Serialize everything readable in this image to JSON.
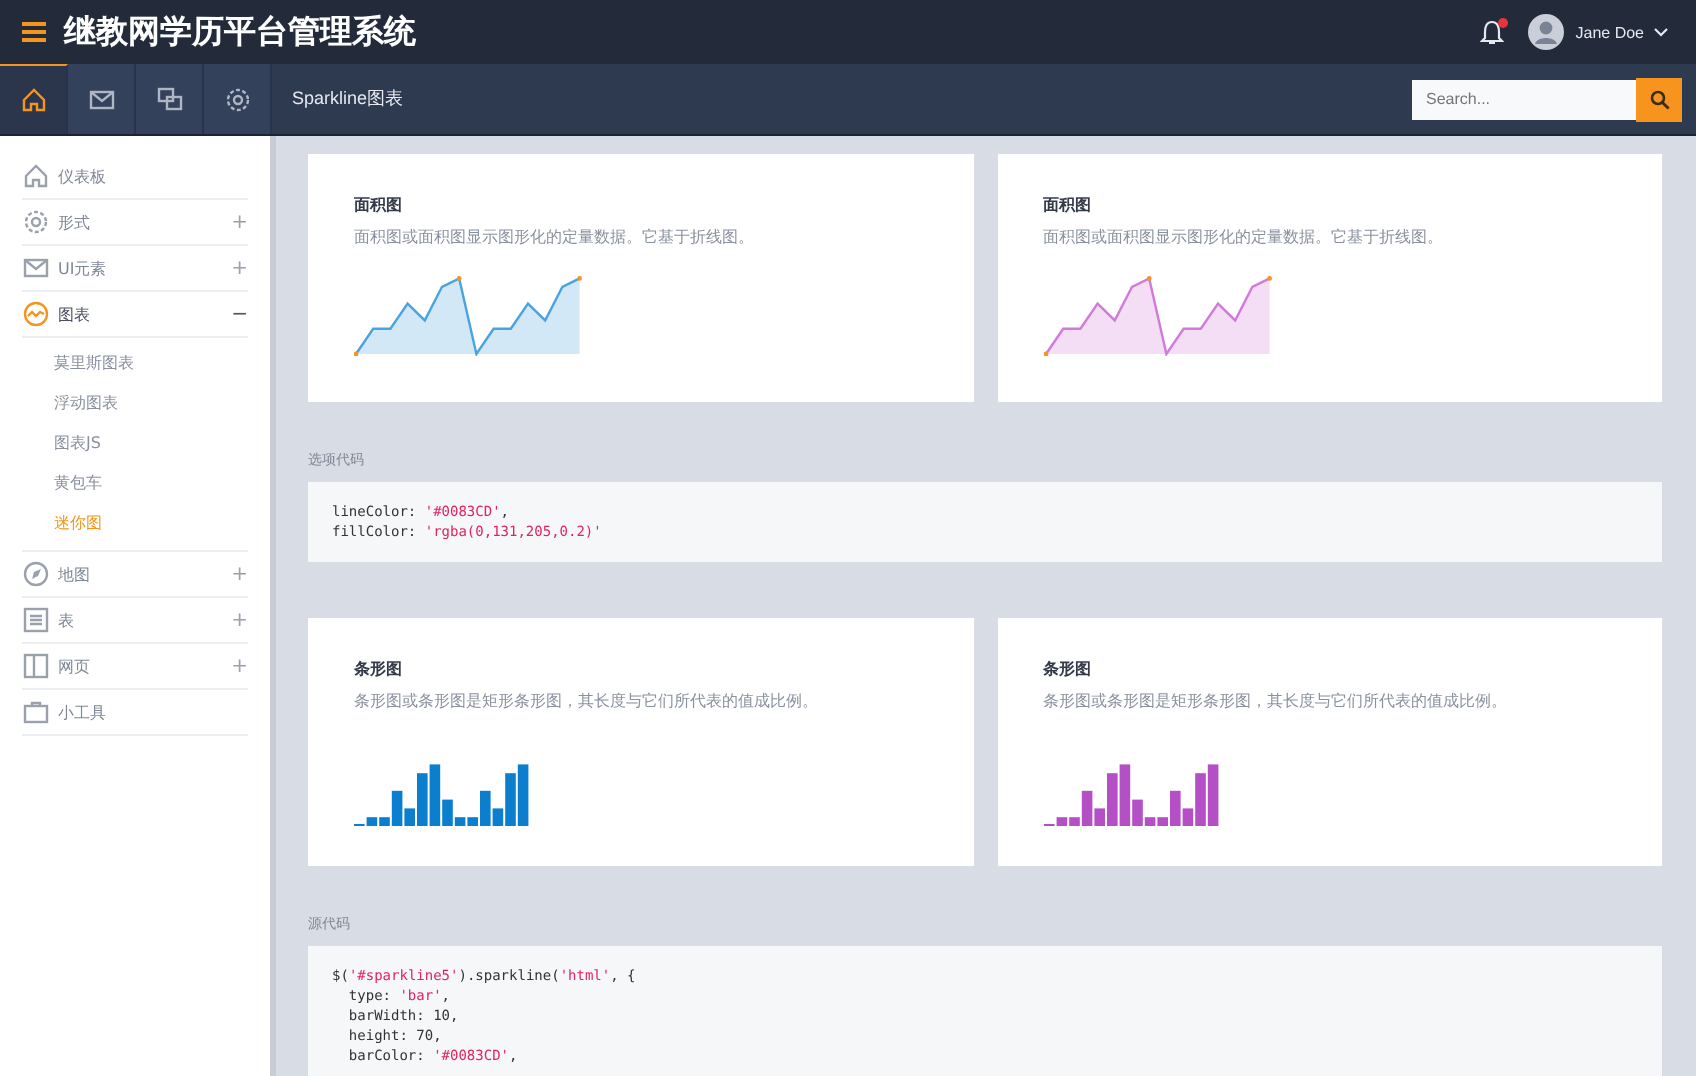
{
  "header": {
    "title": "继教网学历平台管理系统",
    "user": {
      "name": "Jane Doe"
    },
    "notifications": {
      "unread": true
    }
  },
  "toolbar": {
    "tabs": [
      {
        "kind": "home",
        "selected": true
      },
      {
        "kind": "mail",
        "selected": false
      },
      {
        "kind": "chat",
        "selected": false
      },
      {
        "kind": "settings",
        "selected": false
      }
    ],
    "breadcrumb": "Sparkline图表",
    "search": {
      "placeholder": "Search..."
    }
  },
  "sidebar": {
    "items": [
      {
        "kind": "home",
        "label": "仪表板",
        "active": false
      },
      {
        "kind": "settings",
        "label": "形式",
        "toggle": "+",
        "active": false
      },
      {
        "kind": "mail",
        "label": "UI元素",
        "toggle": "+",
        "active": false
      },
      {
        "kind": "chart",
        "label": "图表",
        "toggle": "−",
        "active": true,
        "expanded": true,
        "children": [
          {
            "label": "莫里斯图表",
            "selected": false
          },
          {
            "label": "浮动图表",
            "selected": false
          },
          {
            "label": "图表JS",
            "selected": false
          },
          {
            "label": "黄包车",
            "selected": false
          },
          {
            "label": "迷你图",
            "selected": true
          }
        ]
      },
      {
        "kind": "compass",
        "label": "地图",
        "toggle": "+",
        "active": false
      },
      {
        "kind": "list",
        "label": "表",
        "toggle": "+",
        "active": false
      },
      {
        "kind": "book",
        "label": "网页",
        "toggle": "+",
        "active": false
      },
      {
        "kind": "briefcase",
        "label": "小工具",
        "active": false
      }
    ]
  },
  "sections": [
    {
      "cards": [
        {
          "kind": "area",
          "title": "面积图",
          "description": "面积图或面积图显示图形化的定量数据。它基于折线图。",
          "color": "#4aa3df"
        },
        {
          "kind": "area",
          "title": "面积图",
          "description": "面积图或面积图显示图形化的定量数据。它基于折线图。",
          "color": "#d07ad9"
        }
      ],
      "code_label": "选项代码",
      "code": [
        [
          {
            "kind": "plain",
            "text": "lineColor: "
          },
          {
            "kind": "string",
            "text": "'#0083CD'"
          },
          {
            "kind": "plain",
            "text": ","
          }
        ],
        [
          {
            "kind": "plain",
            "text": "fillColor: "
          },
          {
            "kind": "string",
            "text": "'rgba(0,131,205,0.2)'"
          }
        ]
      ]
    },
    {
      "cards": [
        {
          "kind": "bar",
          "title": "条形图",
          "description": "条形图或条形图是矩形条形图，其长度与它们所代表的值成比例。",
          "color": "#0b7fcd"
        },
        {
          "kind": "bar",
          "title": "条形图",
          "description": "条形图或条形图是矩形条形图，其长度与它们所代表的值成比例。",
          "color": "#b54fc6"
        }
      ],
      "code_label": "源代码",
      "code": [
        [
          {
            "kind": "plain",
            "text": "$("
          },
          {
            "kind": "string",
            "text": "'#sparkline5'"
          },
          {
            "kind": "plain",
            "text": ").sparkline("
          },
          {
            "kind": "string",
            "text": "'html'"
          },
          {
            "kind": "plain",
            "text": ", {"
          }
        ],
        [
          {
            "kind": "plain",
            "text": "  type: "
          },
          {
            "kind": "string",
            "text": "'bar'"
          },
          {
            "kind": "plain",
            "text": ","
          }
        ],
        [
          {
            "kind": "plain",
            "text": "  barWidth: 10,"
          }
        ],
        [
          {
            "kind": "plain",
            "text": "  height: 70,"
          }
        ],
        [
          {
            "kind": "plain",
            "text": "  barColor: "
          },
          {
            "kind": "string",
            "text": "'#0083CD'"
          },
          {
            "kind": "plain",
            "text": ","
          }
        ]
      ]
    }
  ]
}
